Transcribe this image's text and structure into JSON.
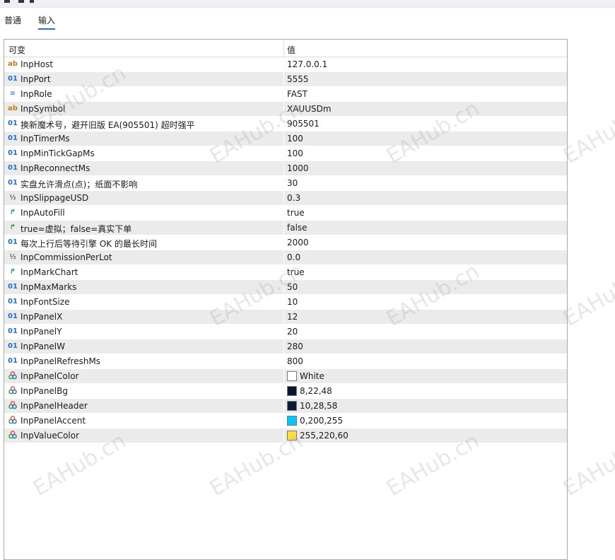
{
  "tabs": [
    {
      "label": "普通",
      "active": false
    },
    {
      "label": "输入",
      "active": true
    }
  ],
  "table": {
    "columns": [
      "可变",
      "值"
    ],
    "rows": [
      {
        "icon": "ab",
        "icon_name": "string-type-icon",
        "name": "InpHost",
        "value": "127.0.0.1"
      },
      {
        "icon": "01",
        "icon_name": "integer-type-icon",
        "name": "InpPort",
        "value": "5555"
      },
      {
        "icon": "≡",
        "icon_name": "enum-type-icon",
        "name": "InpRole",
        "value": "FAST"
      },
      {
        "icon": "ab",
        "icon_name": "string-type-icon",
        "name": "InpSymbol",
        "value": "XAUUSDm"
      },
      {
        "icon": "01",
        "icon_name": "integer-type-icon",
        "name": "换新魔术号，避开旧版 EA(905501) 超时强平",
        "value": "905501"
      },
      {
        "icon": "01",
        "icon_name": "integer-type-icon",
        "name": "InpTimerMs",
        "value": "100"
      },
      {
        "icon": "01",
        "icon_name": "integer-type-icon",
        "name": "InpMinTickGapMs",
        "value": "100"
      },
      {
        "icon": "01",
        "icon_name": "integer-type-icon",
        "name": "InpReconnectMs",
        "value": "1000"
      },
      {
        "icon": "01",
        "icon_name": "integer-type-icon",
        "name": "实盘允许滑点(点)；纸面不影响",
        "value": "30"
      },
      {
        "icon": "½",
        "icon_name": "double-type-icon",
        "name": "InpSlippageUSD",
        "value": "0.3"
      },
      {
        "icon": "↱",
        "icon_name": "bool-type-icon",
        "name": "InpAutoFill",
        "value": "true"
      },
      {
        "icon": "↱",
        "icon_name": "bool-type-icon",
        "name": "true=虚拟；false=真实下单",
        "value": "false"
      },
      {
        "icon": "01",
        "icon_name": "integer-type-icon",
        "name": "每次上行后等待引擎 OK 的最长时间",
        "value": "2000"
      },
      {
        "icon": "½",
        "icon_name": "double-type-icon",
        "name": "InpCommissionPerLot",
        "value": "0.0"
      },
      {
        "icon": "↱",
        "icon_name": "bool-type-icon",
        "name": "InpMarkChart",
        "value": "true"
      },
      {
        "icon": "01",
        "icon_name": "integer-type-icon",
        "name": "InpMaxMarks",
        "value": "50"
      },
      {
        "icon": "01",
        "icon_name": "integer-type-icon",
        "name": "InpFontSize",
        "value": "10"
      },
      {
        "icon": "01",
        "icon_name": "integer-type-icon",
        "name": "InpPanelX",
        "value": "12"
      },
      {
        "icon": "01",
        "icon_name": "integer-type-icon",
        "name": "InpPanelY",
        "value": "20"
      },
      {
        "icon": "01",
        "icon_name": "integer-type-icon",
        "name": "InpPanelW",
        "value": "280"
      },
      {
        "icon": "01",
        "icon_name": "integer-type-icon",
        "name": "InpPanelRefreshMs",
        "value": "800"
      },
      {
        "icon": "❀",
        "icon_name": "color-type-icon",
        "name": "InpPanelColor",
        "value": "White",
        "swatch": "#ffffff"
      },
      {
        "icon": "❀",
        "icon_name": "color-type-icon",
        "name": "InpPanelBg",
        "value": "8,22,48",
        "swatch": "#081630"
      },
      {
        "icon": "❀",
        "icon_name": "color-type-icon",
        "name": "InpPanelHeader",
        "value": "10,28,58",
        "swatch": "#0a1c3a"
      },
      {
        "icon": "❀",
        "icon_name": "color-type-icon",
        "name": "InpPanelAccent",
        "value": "0,200,255",
        "swatch": "#00c8ff"
      },
      {
        "icon": "❀",
        "icon_name": "color-type-icon",
        "name": "InpValueColor",
        "value": "255,220,60",
        "swatch": "#ffdc3c"
      }
    ]
  },
  "watermark_text": "EAHub.cn",
  "colors": {
    "accent": "#1f6fd1",
    "row_alt": "#ebebeb",
    "string_icon": "#c77b19",
    "bool_icon": "#2a9a3a"
  }
}
